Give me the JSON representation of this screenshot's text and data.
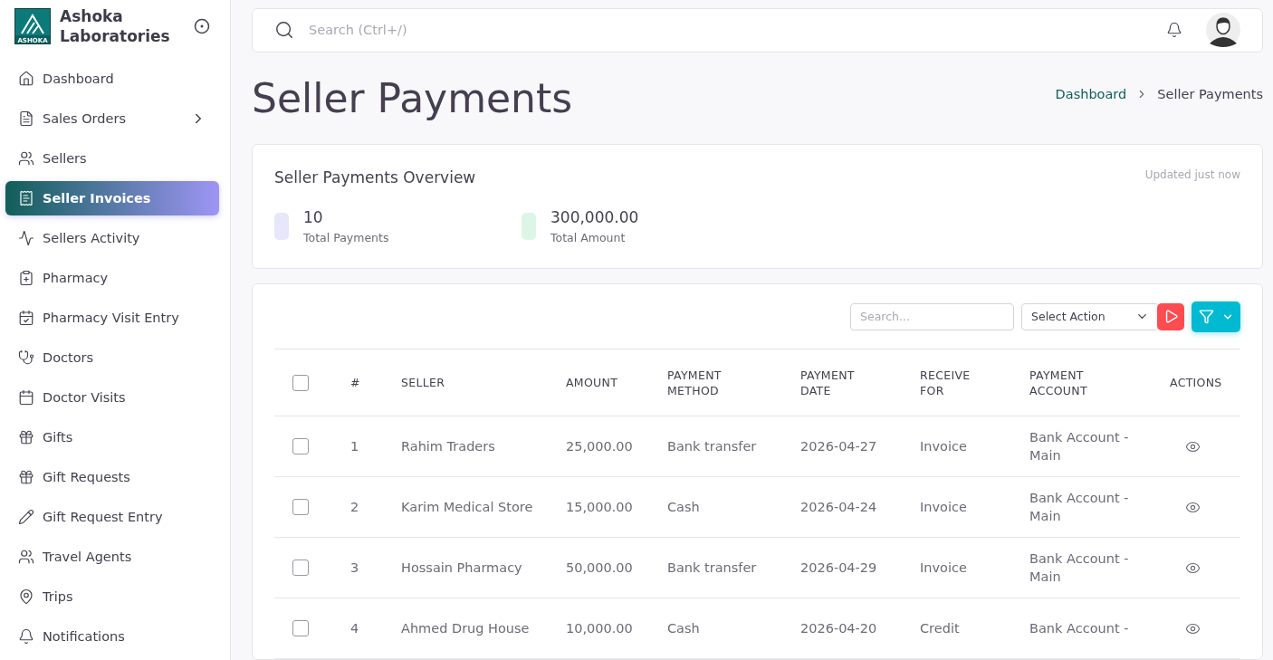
{
  "brand": {
    "line_1": "Ashoka",
    "line_2": "Laboratories",
    "logo_text": "ASHOKA"
  },
  "sidebar": {
    "items": [
      {
        "label": "Dashboard",
        "selected": false
      },
      {
        "label": "Sales Orders",
        "selected": false,
        "has_submenu": true
      },
      {
        "label": "Sellers",
        "selected": false
      },
      {
        "label": "Seller Invoices",
        "selected": true
      },
      {
        "label": "Sellers Activity",
        "selected": false
      },
      {
        "label": "Pharmacy",
        "selected": false
      },
      {
        "label": "Pharmacy Visit Entry",
        "selected": false
      },
      {
        "label": "Doctors",
        "selected": false
      },
      {
        "label": "Doctor Visits",
        "selected": false
      },
      {
        "label": "Gifts",
        "selected": false
      },
      {
        "label": "Gift Requests",
        "selected": false
      },
      {
        "label": "Gift Request Entry",
        "selected": false
      },
      {
        "label": "Travel Agents",
        "selected": false
      },
      {
        "label": "Trips",
        "selected": false
      },
      {
        "label": "Notifications",
        "selected": false
      }
    ]
  },
  "topbar": {
    "search_placeholder": "Search (Ctrl+/)"
  },
  "page": {
    "title": "Seller Payments",
    "breadcrumb": [
      "Dashboard",
      "Seller Payments"
    ]
  },
  "overview": {
    "title": "Seller Payments Overview",
    "updated": "Updated just now",
    "stats": [
      {
        "value": "10",
        "label": "Total Payments",
        "color": "#e8e6fb"
      },
      {
        "value": "300,000.00",
        "label": "Total Amount",
        "color": "#dcf5e7"
      }
    ]
  },
  "table": {
    "search_placeholder": "Search...",
    "action_select": "Select Action",
    "columns": [
      "#",
      "SELLER",
      "AMOUNT",
      "PAYMENT METHOD",
      "PAYMENT DATE",
      "RECEIVE FOR",
      "PAYMENT ACCOUNT",
      "ACTIONS"
    ],
    "header_checked": false,
    "rows": [
      {
        "checked": false,
        "no": "1",
        "seller": "Rahim Traders",
        "amount": "25,000.00",
        "method": "Bank transfer",
        "date": "2026-04-27",
        "receive_for": "Invoice",
        "account": "Bank Account - Main"
      },
      {
        "checked": false,
        "no": "2",
        "seller": "Karim Medical Store",
        "amount": "15,000.00",
        "method": "Cash",
        "date": "2026-04-24",
        "receive_for": "Invoice",
        "account": "Bank Account - Main"
      },
      {
        "checked": false,
        "no": "3",
        "seller": "Hossain Pharmacy",
        "amount": "50,000.00",
        "method": "Bank transfer",
        "date": "2026-04-29",
        "receive_for": "Invoice",
        "account": "Bank Account - Main"
      },
      {
        "checked": false,
        "no": "4",
        "seller": "Ahmed Drug House",
        "amount": "10,000.00",
        "method": "Cash",
        "date": "2026-04-20",
        "receive_for": "Credit",
        "account": "Bank Account -"
      }
    ]
  }
}
